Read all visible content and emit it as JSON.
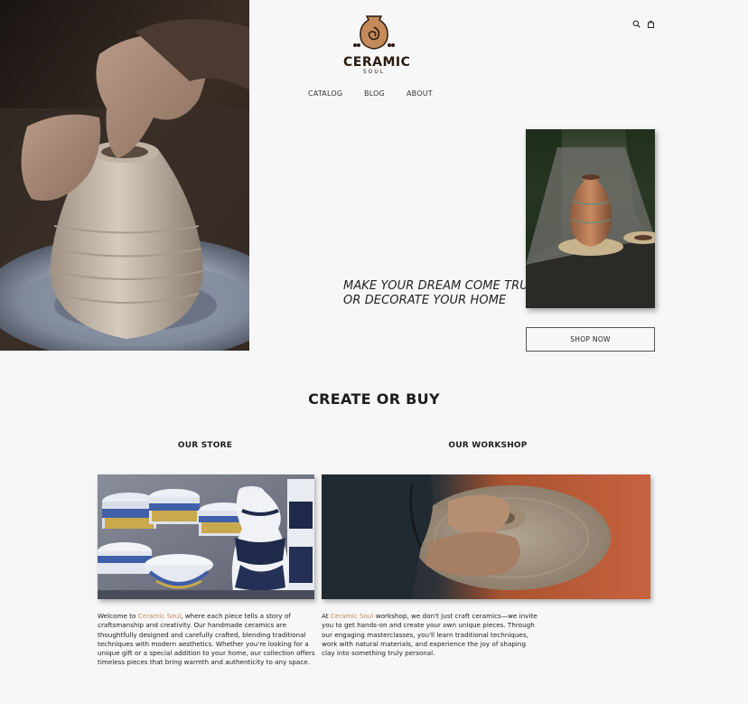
{
  "brand": {
    "name": "CERAMIC",
    "sub": "SOUL"
  },
  "header": {
    "icons": [
      "search-icon",
      "shopping-bag-icon"
    ]
  },
  "nav": {
    "items": [
      {
        "label": "CATALOG"
      },
      {
        "label": "BLOG"
      },
      {
        "label": "ABOUT"
      }
    ]
  },
  "hero": {
    "tagline_line1": "MAKE YOUR DREAM COME TRUE",
    "tagline_line2": "OR DECORATE YOUR HOME",
    "cta_label": "SHOP NOW"
  },
  "section": {
    "title": "CREATE OR BUY",
    "store": {
      "title": "OUR STORE",
      "text_before": "Welcome to ",
      "brand_link": "Ceramic Soul",
      "text_after": ", where each piece tells a story of craftsmanship and creativity. Our handmade ceramics are thoughtfully designed and carefully crafted, blending traditional techniques with modern aesthetics. Whether you're looking for a unique gift or a special addition to your home, our collection offers timeless pieces that bring warmth and authenticity to any space."
    },
    "workshop": {
      "title": "OUR WORKSHOP",
      "text_before": "At ",
      "brand_link": "Ceramic Soul",
      "text_after": " workshop, we don't just craft ceramics—we invite you to get hands-on and create your own unique pieces. Through our engaging masterclasses, you'll learn traditional techniques, work with natural materials, and experience the joy of shaping clay into something truly personal."
    }
  },
  "colors": {
    "background": "#f7f7f8",
    "accent": "#c58a5a",
    "text": "#1c1c1c"
  }
}
